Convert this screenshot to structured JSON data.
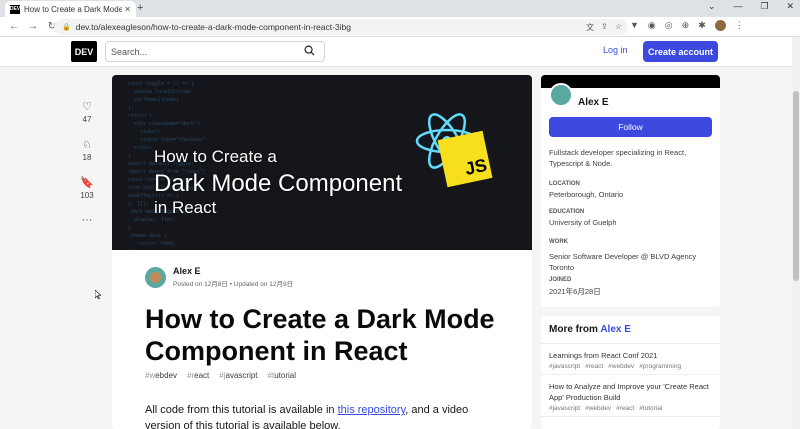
{
  "browser": {
    "tab_title": "How to Create a Dark Mode C",
    "tab_favicon": "DEV",
    "url": "dev.to/alexeagleson/how-to-create-a-dark-mode-component-in-react-3ibg"
  },
  "header": {
    "logo": "DEV",
    "search_placeholder": "Search...",
    "login": "Log in",
    "create_account": "Create account"
  },
  "reactions": [
    {
      "icon": "heart-icon",
      "count": "47"
    },
    {
      "icon": "unicorn-icon",
      "count": "18"
    },
    {
      "icon": "bookmark-icon",
      "count": "103"
    }
  ],
  "cover": {
    "line1": "How to Create a",
    "line2": "Dark Mode Component",
    "line3": "in React",
    "badge": "JS"
  },
  "post": {
    "author": "Alex E",
    "meta": "Posted on 12月8日 • Updated on 12月9日",
    "title": "How to Create a Dark Mode Component in React",
    "tags": [
      "#webdev",
      "#react",
      "#javascript",
      "#tutorial"
    ],
    "body_before_link": "All code from this tutorial is available in ",
    "body_link": "this repository",
    "body_after_link": ", and a video version of this tutorial is available below."
  },
  "sidebar": {
    "name": "Alex E",
    "follow": "Follow",
    "bio": "Fullstack developer specializing in React, Typescript & Node.",
    "location_label": "LOCATION",
    "location": "Peterborough, Ontario",
    "education_label": "EDUCATION",
    "education": "University of Guelph",
    "work_label": "WORK",
    "work": "Senior Software Developer @ BLVD Agency Toronto",
    "joined_label": "JOINED",
    "joined": "2021年6月28日"
  },
  "more": {
    "heading_prefix": "More from ",
    "heading_name": "Alex E",
    "items": [
      {
        "title": "Learnings from React Conf 2021",
        "tags": [
          "#javascript",
          "#react",
          "#webdev",
          "#programming"
        ]
      },
      {
        "title": "How to Analyze and Improve your 'Create React App' Production Build",
        "tags": [
          "#javascript",
          "#webdev",
          "#react",
          "#tutorial"
        ]
      }
    ]
  }
}
